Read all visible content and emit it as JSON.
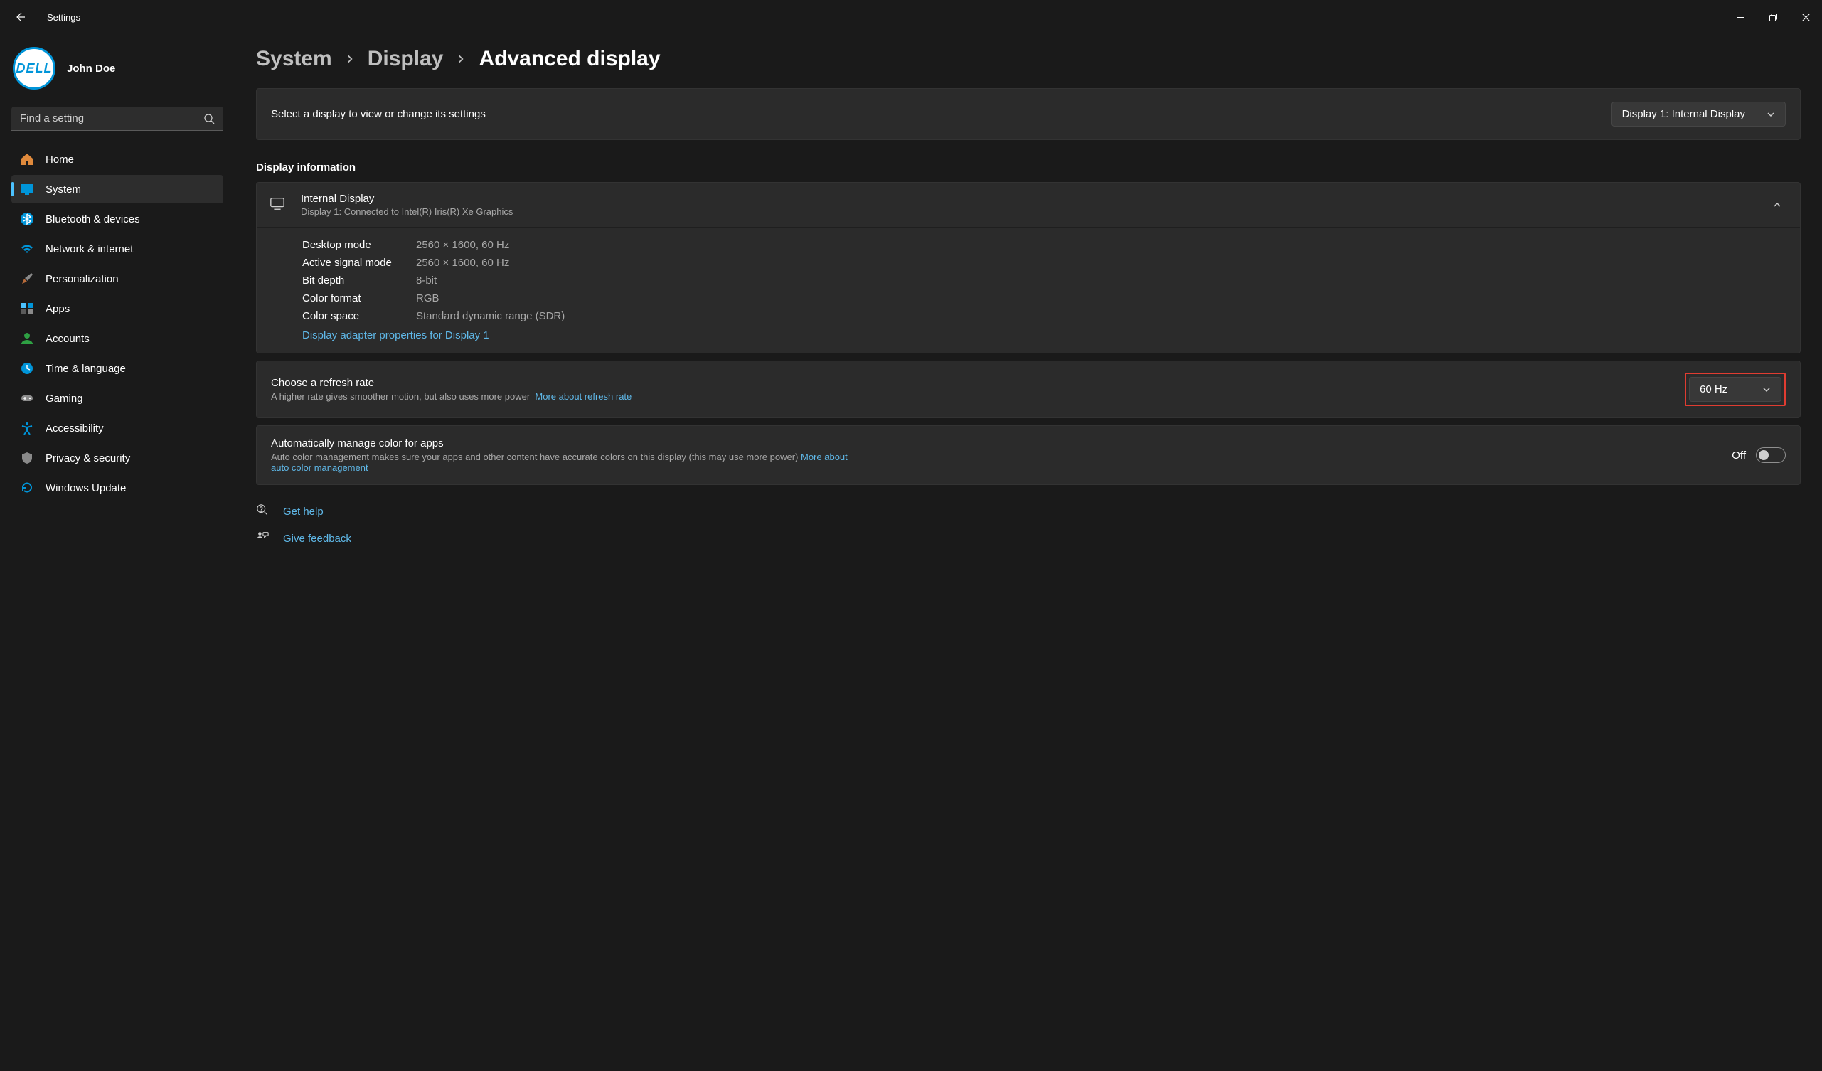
{
  "window": {
    "title": "Settings"
  },
  "user": {
    "name": "John Doe",
    "avatar_label": "DELL"
  },
  "search": {
    "placeholder": "Find a setting"
  },
  "sidebar": {
    "items": [
      {
        "label": "Home"
      },
      {
        "label": "System"
      },
      {
        "label": "Bluetooth & devices"
      },
      {
        "label": "Network & internet"
      },
      {
        "label": "Personalization"
      },
      {
        "label": "Apps"
      },
      {
        "label": "Accounts"
      },
      {
        "label": "Time & language"
      },
      {
        "label": "Gaming"
      },
      {
        "label": "Accessibility"
      },
      {
        "label": "Privacy & security"
      },
      {
        "label": "Windows Update"
      }
    ],
    "active_index": 1
  },
  "breadcrumb": {
    "level1": "System",
    "level2": "Display",
    "level3": "Advanced display"
  },
  "select_display": {
    "prompt": "Select a display to view or change its settings",
    "selected": "Display 1: Internal Display"
  },
  "section_heading": "Display information",
  "display_info": {
    "title": "Internal Display",
    "subtitle": "Display 1: Connected to Intel(R) Iris(R) Xe Graphics",
    "rows": {
      "desktop_mode_label": "Desktop mode",
      "desktop_mode_value": "2560 × 1600, 60 Hz",
      "active_signal_mode_label": "Active signal mode",
      "active_signal_mode_value": "2560 × 1600, 60 Hz",
      "bit_depth_label": "Bit depth",
      "bit_depth_value": "8-bit",
      "color_format_label": "Color format",
      "color_format_value": "RGB",
      "color_space_label": "Color space",
      "color_space_value": "Standard dynamic range (SDR)"
    },
    "adapter_link": "Display adapter properties for Display 1"
  },
  "refresh_rate": {
    "title": "Choose a refresh rate",
    "subtitle": "A higher rate gives smoother motion, but also uses more power",
    "more_link": "More about refresh rate",
    "selected": "60 Hz"
  },
  "auto_color": {
    "title": "Automatically manage color for apps",
    "subtitle": "Auto color management makes sure your apps and other content have accurate colors on this display (this may use more power)",
    "more_link": "More about auto color management",
    "state_label": "Off"
  },
  "footer": {
    "get_help": "Get help",
    "give_feedback": "Give feedback"
  }
}
